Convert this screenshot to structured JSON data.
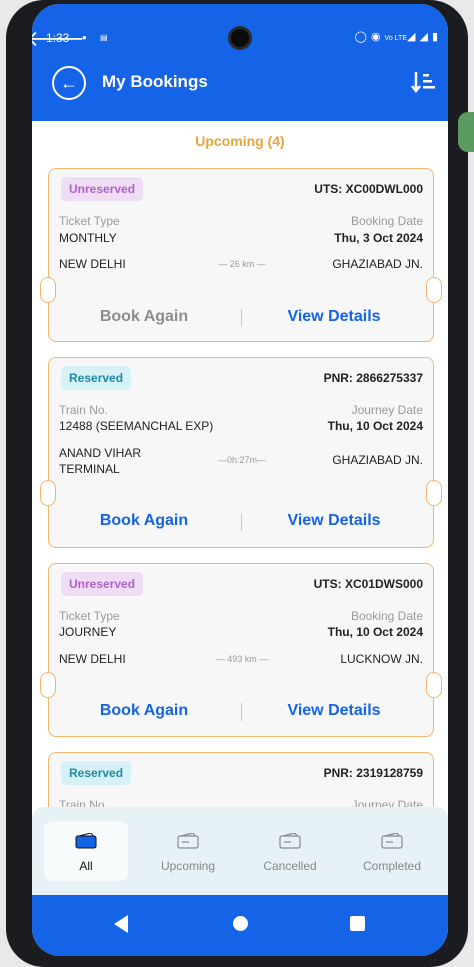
{
  "status_bar": {
    "time": "1:33",
    "network": "Vo LTE"
  },
  "header": {
    "title": "My Bookings"
  },
  "section": {
    "title": "Upcoming (4)"
  },
  "bookings": [
    {
      "badge": "Unreserved",
      "code_label": "UTS:",
      "code_value": "XC00DWL000",
      "left_label": "Ticket Type",
      "left_value": "MONTHLY",
      "right_label": "Booking Date",
      "right_value": "Thu, 3 Oct 2024",
      "from": "NEW DELHI",
      "distance": "26 km",
      "to": "GHAZIABAD JN.",
      "action_primary": "Book Again",
      "action_secondary": "View Details"
    },
    {
      "badge": "Reserved",
      "code_label": "PNR:",
      "code_value": "2866275337",
      "left_label": "Train No.",
      "left_value": "12488 (SEEMANCHAL EXP)",
      "right_label": "Journey Date",
      "right_value": "Thu, 10 Oct 2024",
      "from": "ANAND VIHAR TERMINAL",
      "distance": "0h:27m",
      "to": "GHAZIABAD JN.",
      "action_primary": "Book Again",
      "action_secondary": "View Details"
    },
    {
      "badge": "Unreserved",
      "code_label": "UTS:",
      "code_value": "XC01DWS000",
      "left_label": "Ticket Type",
      "left_value": "JOURNEY",
      "right_label": "Booking Date",
      "right_value": "Thu, 10 Oct 2024",
      "from": "NEW DELHI",
      "distance": "493 km",
      "to": "LUCKNOW JN.",
      "action_primary": "Book Again",
      "action_secondary": "View Details"
    },
    {
      "badge": "Reserved",
      "code_label": "PNR:",
      "code_value": "2319128759",
      "left_label": "Train No.",
      "right_label": "Journey Date"
    }
  ],
  "tabs": [
    {
      "label": "All",
      "active": true
    },
    {
      "label": "Upcoming",
      "active": false
    },
    {
      "label": "Cancelled",
      "active": false
    },
    {
      "label": "Completed",
      "active": false
    }
  ],
  "colors": {
    "primary": "#1563e6",
    "accent": "#e8a33a",
    "unreserved": "#b063c8",
    "reserved": "#1e8aa6"
  }
}
